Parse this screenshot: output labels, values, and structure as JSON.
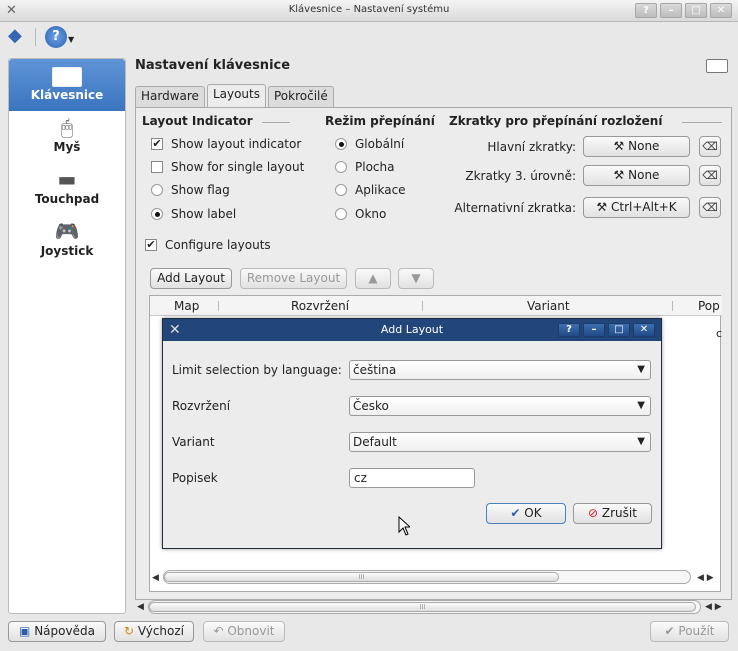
{
  "window": {
    "title": "Klávesnice – Nastavení systému"
  },
  "titlebar_buttons": [
    "?",
    "–",
    "□",
    "✕"
  ],
  "sidebar": {
    "items": [
      {
        "label": "Klávesnice",
        "icon": "keyboard-icon"
      },
      {
        "label": "Myš",
        "icon": "mouse-icon"
      },
      {
        "label": "Touchpad",
        "icon": "touchpad-icon"
      },
      {
        "label": "Joystick",
        "icon": "joystick-icon"
      }
    ]
  },
  "page": {
    "heading": "Nastavení klávesnice"
  },
  "tabs": [
    "Hardware",
    "Layouts",
    "Pokročilé"
  ],
  "layout_indicator": {
    "title": "Layout Indicator",
    "options": [
      "Show layout indicator",
      "Show for single layout",
      "Show flag",
      "Show label"
    ]
  },
  "switch_mode": {
    "title": "Režim přepínání",
    "options": [
      "Globální",
      "Plocha",
      "Aplikace",
      "Okno"
    ]
  },
  "shortcuts": {
    "title": "Zkratky pro přepínání rozložení",
    "rows": [
      {
        "label": "Hlavní zkratky:",
        "value": "None"
      },
      {
        "label": "Zkratky 3. úrovně:",
        "value": "None"
      },
      {
        "label": "Alternativní zkratka:",
        "value": "Ctrl+Alt+K"
      }
    ]
  },
  "configure_layouts": "Configure layouts",
  "layout_buttons": {
    "add": "Add Layout",
    "remove": "Remove Layout"
  },
  "table": {
    "columns": [
      "Map",
      "Rozvržení",
      "Variant",
      "Pop"
    ],
    "peek": "c"
  },
  "dialog": {
    "title": "Add Layout",
    "buttons": [
      "?",
      "–",
      "□",
      "✕"
    ],
    "fields": [
      {
        "label": "Limit selection by language:",
        "value": "čeština"
      },
      {
        "label": "Rozvržení",
        "value": "Česko"
      },
      {
        "label": "Variant",
        "value": "Default"
      },
      {
        "label": "Popisek",
        "value": "cz"
      }
    ],
    "ok": "OK",
    "cancel": "Zrušit"
  },
  "scroll_marker": "III",
  "bottom_buttons": {
    "help": "Nápověda",
    "defaults": "Výchozí",
    "reset": "Obnovit",
    "apply": "Použít"
  }
}
